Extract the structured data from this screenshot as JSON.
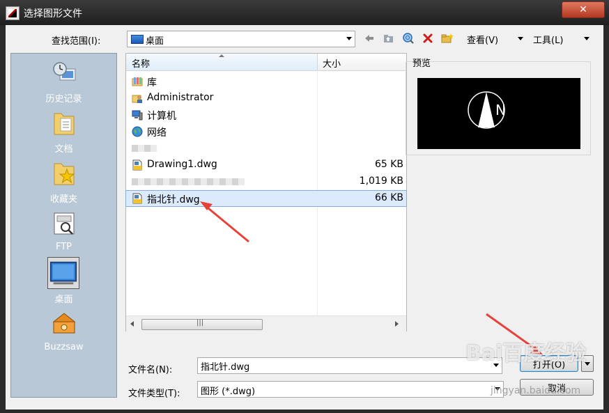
{
  "window": {
    "title": "选择图形文件",
    "close_symbol": "✕"
  },
  "toolbar": {
    "look_in_label": "查找范围(I):",
    "look_in_value": "桌面",
    "views_label": "查看(V)",
    "tools_label": "工具(L)",
    "icons": [
      "back-arrow-icon",
      "up-folder-icon",
      "search-web-icon",
      "delete-icon",
      "new-folder-icon"
    ]
  },
  "places": [
    {
      "label": "历史记录",
      "icon": "history-icon"
    },
    {
      "label": "文档",
      "icon": "documents-folder-icon"
    },
    {
      "label": "收藏夹",
      "icon": "favorites-folder-icon"
    },
    {
      "label": "FTP",
      "icon": "ftp-icon"
    },
    {
      "label": "桌面",
      "icon": "desktop-icon",
      "selected": true
    },
    {
      "label": "Buzzsaw",
      "icon": "buzzsaw-icon"
    }
  ],
  "file_list": {
    "columns": {
      "name": "名称",
      "size": "大小"
    },
    "rows": [
      {
        "name": "库",
        "size": "",
        "icon": "library-icon"
      },
      {
        "name": "Administrator",
        "size": "",
        "icon": "user-folder-icon"
      },
      {
        "name": "计算机",
        "size": "",
        "icon": "computer-icon"
      },
      {
        "name": "网络",
        "size": "",
        "icon": "network-icon"
      },
      {
        "name": "",
        "size": "",
        "icon": "blurred-item"
      },
      {
        "name": "Drawing1.dwg",
        "size": "65 KB",
        "icon": "dwg-file-icon"
      },
      {
        "name": "",
        "size": "1,019 KB",
        "icon": "blurred-item"
      },
      {
        "name": "指北针.dwg",
        "size": "66 KB",
        "icon": "dwg-file-icon",
        "selected": true
      }
    ]
  },
  "preview": {
    "label": "预览",
    "letter": "N",
    "background": "#000000"
  },
  "form": {
    "file_name_label": "文件名(N):",
    "file_name_value": "指北针.dwg",
    "file_type_label": "文件类型(T):",
    "file_type_value": "图形 (*.dwg)",
    "open_label": "打开(O)",
    "cancel_label": "取消"
  },
  "watermark": {
    "main": "Bai百度经验",
    "sub": "jingyan.baidu.com"
  },
  "colors": {
    "places_bg": "#b9c8d6",
    "selection": "#dcebfc",
    "annotation_arrow": "#e8413a"
  }
}
